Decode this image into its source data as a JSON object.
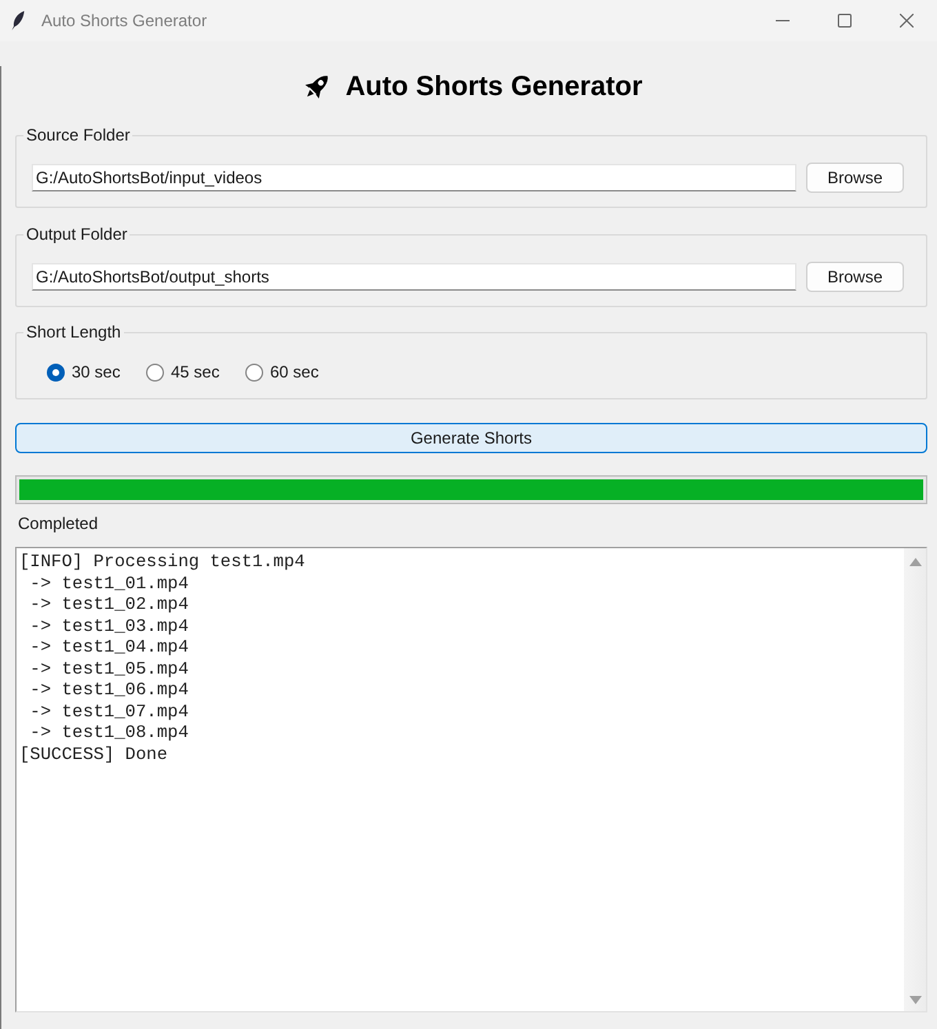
{
  "window": {
    "title": "Auto Shorts Generator"
  },
  "heading": {
    "text": "Auto Shorts Generator"
  },
  "source_folder": {
    "label": "Source Folder",
    "value": "G:/AutoShortsBot/input_videos",
    "button": "Browse"
  },
  "output_folder": {
    "label": "Output Folder",
    "value": "G:/AutoShortsBot/output_shorts",
    "button": "Browse"
  },
  "short_length": {
    "label": "Short Length",
    "options": [
      {
        "label": "30 sec",
        "selected": true
      },
      {
        "label": "45 sec",
        "selected": false
      },
      {
        "label": "60 sec",
        "selected": false
      }
    ]
  },
  "generate_button": {
    "label": "Generate Shorts"
  },
  "progress": {
    "level": 1,
    "status": "Completed"
  },
  "log": {
    "lines": [
      "[INFO] Processing test1.mp4",
      " -> test1_01.mp4",
      " -> test1_02.mp4",
      " -> test1_03.mp4",
      " -> test1_04.mp4",
      " -> test1_05.mp4",
      " -> test1_06.mp4",
      " -> test1_07.mp4",
      " -> test1_08.mp4",
      "[SUCCESS] Done"
    ]
  }
}
